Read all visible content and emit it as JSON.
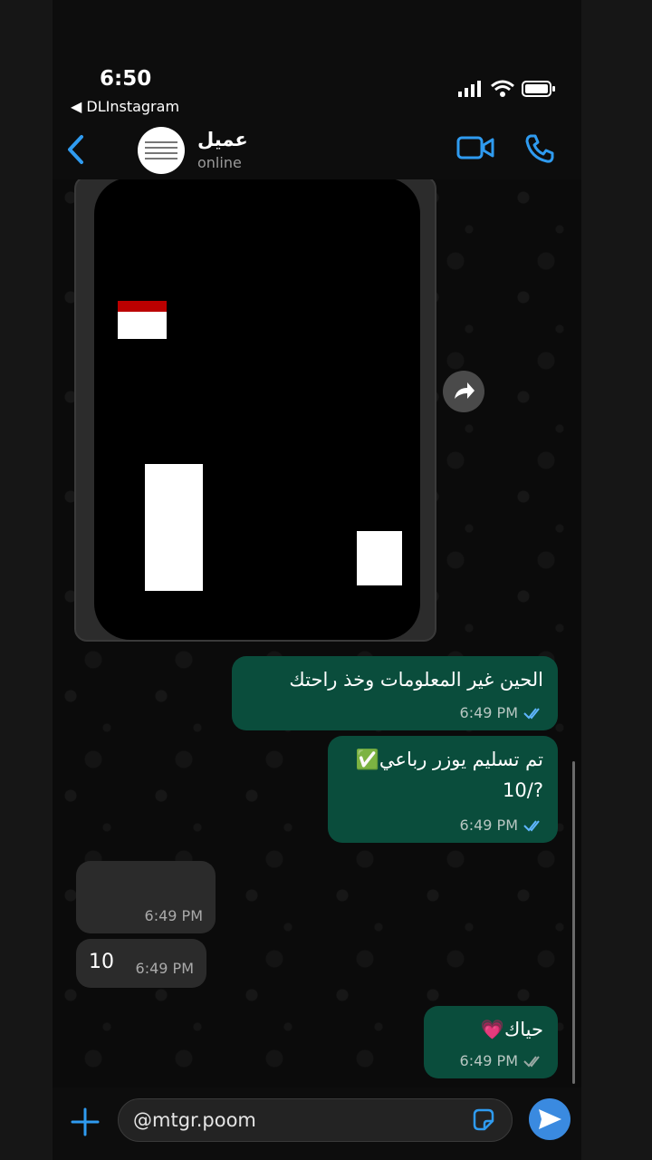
{
  "status_bar": {
    "time": "6:50",
    "back_app": "◀ DLInstagram"
  },
  "header": {
    "contact_name": "عميل",
    "contact_status": "online"
  },
  "messages": [
    {
      "direction": "out",
      "text": "الحين غير المعلومات وخذ راحتك",
      "time": "6:49 PM",
      "read": true
    },
    {
      "direction": "out",
      "text": "تم تسليم يوزر رباعي✅",
      "text2": "10/?",
      "time": "6:49 PM",
      "read": true
    },
    {
      "direction": "in",
      "text": "",
      "time": "6:49 PM"
    },
    {
      "direction": "in",
      "text": "10",
      "time": "6:49 PM"
    },
    {
      "direction": "out",
      "text": "حياك💗",
      "time": "6:49 PM",
      "read": false
    }
  ],
  "composer": {
    "value": "@mtgr.poom"
  },
  "colors": {
    "accent": "#2f9bf0",
    "outgoing_bubble": "#0a4d3c",
    "incoming_bubble": "#2b2b2b",
    "read_tick": "#5fb6ff"
  },
  "icons": [
    "back-icon",
    "video-call-icon",
    "phone-icon",
    "forward-icon",
    "double-check-icon",
    "plus-icon",
    "sticker-icon",
    "send-icon"
  ]
}
